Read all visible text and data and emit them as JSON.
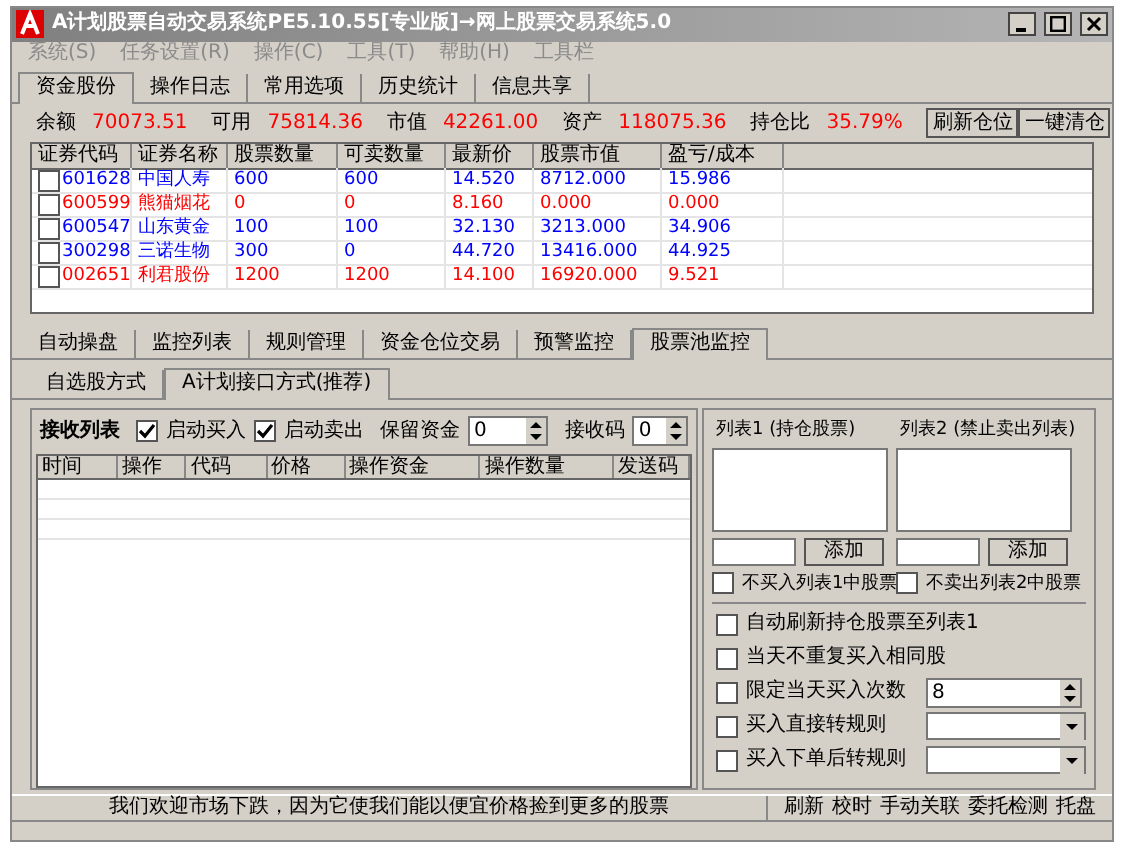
{
  "window": {
    "title": "A计划股票自动交易系统PE5.10.55[专业版]→网上股票交易系统5.0"
  },
  "menu": [
    {
      "label": "系统(S)",
      "disabled": true
    },
    {
      "label": "任务设置(R)",
      "disabled": true
    },
    {
      "label": "操作(C)",
      "disabled": true
    },
    {
      "label": "工具(T)",
      "disabled": true
    },
    {
      "label": "帮助(H)",
      "disabled": true
    },
    {
      "label": "工具栏",
      "disabled": true
    }
  ],
  "tabs": [
    {
      "label": "资金股份",
      "selected": true
    },
    {
      "label": "操作日志",
      "selected": false
    },
    {
      "label": "常用选项",
      "selected": false
    },
    {
      "label": "历史统计",
      "selected": false
    },
    {
      "label": "信息共享",
      "selected": false
    }
  ],
  "summary": [
    {
      "label": "余额",
      "value": "70073.51"
    },
    {
      "label": "可用",
      "value": "75814.36"
    },
    {
      "label": "市值",
      "value": "42261.00"
    },
    {
      "label": "资产",
      "value": "118075.36"
    },
    {
      "label": "持仓比",
      "value": "35.79%"
    }
  ],
  "summary_buttons": [
    "刷新仓位",
    "一键清仓"
  ],
  "holdings": {
    "columns": [
      "证券代码",
      "证券名称",
      "股票数量",
      "可卖数量",
      "最新价",
      "股票市值",
      "盈亏/成本"
    ],
    "rows": [
      {
        "checked": false,
        "color": "#0000ff",
        "cells": [
          "601628",
          "中国人寿",
          "600",
          "600",
          "14.520",
          "8712.000",
          "15.986"
        ]
      },
      {
        "checked": false,
        "color": "#ff0000",
        "cells": [
          "600599",
          "熊猫烟花",
          "0",
          "0",
          "8.160",
          "0.000",
          "0.000"
        ]
      },
      {
        "checked": false,
        "color": "#0000ff",
        "cells": [
          "600547",
          "山东黄金",
          "100",
          "100",
          "32.130",
          "3213.000",
          "34.906"
        ]
      },
      {
        "checked": false,
        "color": "#0000ff",
        "cells": [
          "300298",
          "三诺生物",
          "300",
          "0",
          "44.720",
          "13416.000",
          "44.925"
        ]
      },
      {
        "checked": false,
        "color": "#ff0000",
        "cells": [
          "002651",
          "利君股份",
          "1200",
          "1200",
          "14.100",
          "16920.000",
          "9.521"
        ]
      }
    ]
  },
  "lower_tabs": [
    {
      "label": "自动操盘",
      "selected": false
    },
    {
      "label": "监控列表",
      "selected": false
    },
    {
      "label": "规则管理",
      "selected": false
    },
    {
      "label": "资金仓位交易",
      "selected": false
    },
    {
      "label": "预警监控",
      "selected": false
    },
    {
      "label": "股票池监控",
      "selected": true
    }
  ],
  "sub_tabs": [
    {
      "label": "自选股方式",
      "selected": false
    },
    {
      "label": "A计划接口方式(推荐)",
      "selected": true
    }
  ],
  "receive": {
    "title": "接收列表",
    "start_buy": {
      "label": "启动买入",
      "checked": true
    },
    "start_sell": {
      "label": "启动卖出",
      "checked": true
    },
    "reserve": {
      "label": "保留资金",
      "value": "0"
    },
    "code": {
      "label": "接收码",
      "value": "0"
    },
    "columns": [
      "时间",
      "操作",
      "代码",
      "价格",
      "操作资金",
      "操作数量",
      "发送码"
    ]
  },
  "lists": [
    {
      "label": "列表1 (持仓股票)",
      "button": "添加",
      "option": {
        "label": "不买入列表1中股票",
        "checked": false
      }
    },
    {
      "label": "列表2 (禁止卖出列表)",
      "button": "添加",
      "option": {
        "label": "不卖出列表2中股票",
        "checked": false
      }
    }
  ],
  "options": [
    {
      "kind": "check",
      "label": "自动刷新持仓股票至列表1",
      "checked": false
    },
    {
      "kind": "check",
      "label": "当天不重复买入相同股",
      "checked": false
    },
    {
      "kind": "spin",
      "label": "限定当天买入次数",
      "checked": false,
      "value": "8"
    },
    {
      "kind": "combo",
      "label": "买入直接转规则",
      "checked": false
    },
    {
      "kind": "combo",
      "label": "买入下单后转规则",
      "checked": false
    }
  ],
  "status": {
    "message": "我们欢迎市场下跌，因为它使我们能以便宜价格捡到更多的股票",
    "buttons": [
      "刷新",
      "校时",
      "手动关联",
      "委托检测",
      "托盘"
    ]
  }
}
